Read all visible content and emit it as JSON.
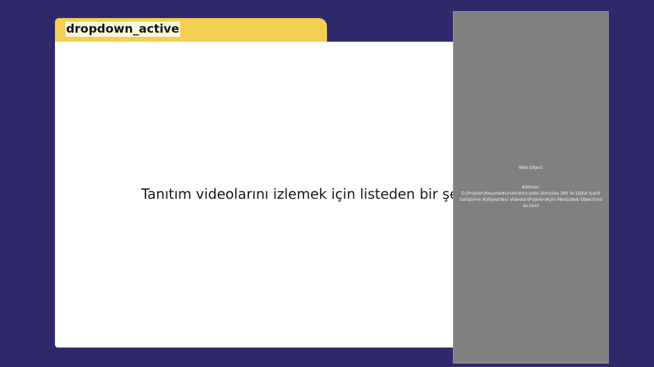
{
  "tab": {
    "label": "dropdown_active"
  },
  "content": {
    "instruction": "Tanıtım videolarını izlemek için listeden bir şehir seçin."
  },
  "web_object": {
    "title": "Web Object",
    "address_label": "Address:",
    "address_value": "D:\\Projeler\\Resume\\Kursler\\Articulate Storyline 360 ile Dijital İçerik Geliştirme Atölyesi\\Yeni Videolar\\Projeler\\Açılır Menü\\Web Object\\index.html"
  },
  "colors": {
    "background": "#2f296b",
    "tab": "#f2ce52",
    "panel": "#ffffff",
    "web_object": "#808080"
  }
}
